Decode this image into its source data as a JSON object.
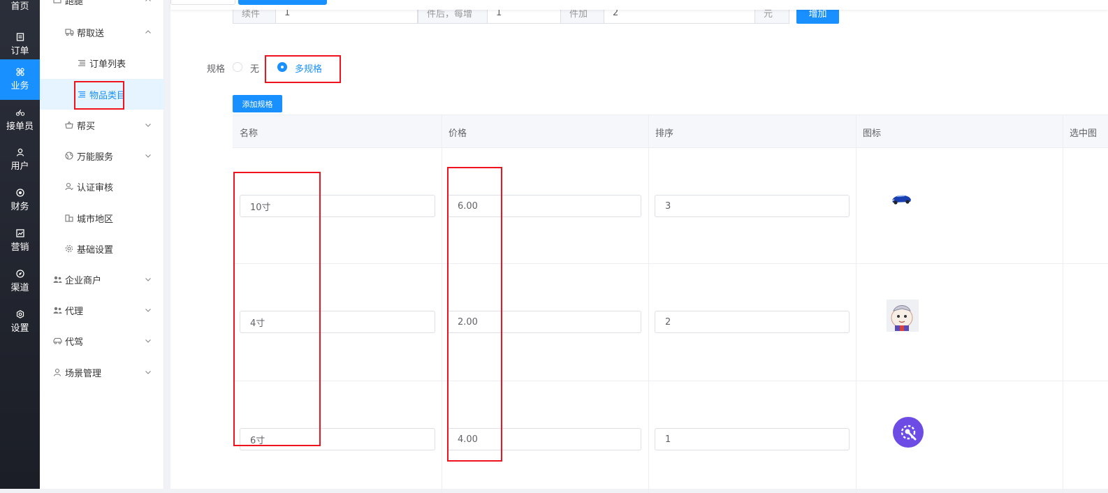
{
  "rail": {
    "items": [
      {
        "label": "首页",
        "icon": "home-icon"
      },
      {
        "label": "订单",
        "icon": "order-icon"
      },
      {
        "label": "业务",
        "icon": "command-icon",
        "active": true
      },
      {
        "label": "接单员",
        "icon": "bike-icon"
      },
      {
        "label": "用户",
        "icon": "user-icon"
      },
      {
        "label": "财务",
        "icon": "finance-icon"
      },
      {
        "label": "营销",
        "icon": "chart-icon"
      },
      {
        "label": "渠道",
        "icon": "compass-icon"
      },
      {
        "label": "设置",
        "icon": "settings-icon"
      }
    ]
  },
  "menu": {
    "items": [
      {
        "label": "跑腿",
        "icon": "errand-icon",
        "chevron": "up"
      },
      {
        "label": "帮取送",
        "icon": "delivery-icon",
        "chevron": "up"
      },
      {
        "label": "订单列表",
        "icon": "list-icon"
      },
      {
        "label": "物品类目",
        "icon": "list-icon",
        "selected": true
      },
      {
        "label": "帮买",
        "icon": "basket-icon",
        "chevron": "down"
      },
      {
        "label": "万能服务",
        "icon": "globe-icon",
        "chevron": "down"
      },
      {
        "label": "认证审核",
        "icon": "user-check-icon"
      },
      {
        "label": "城市地区",
        "icon": "city-icon"
      },
      {
        "label": "基础设置",
        "icon": "gear-icon"
      },
      {
        "label": "企业商户",
        "icon": "users-icon",
        "chevron": "down"
      },
      {
        "label": "代理",
        "icon": "users-icon",
        "chevron": "down"
      },
      {
        "label": "代驾",
        "icon": "car-icon",
        "chevron": "down"
      },
      {
        "label": "场景管理",
        "icon": "user-icon",
        "chevron": "down"
      }
    ]
  },
  "pricing_row": {
    "label1": "续件",
    "value1": "1",
    "label2": "件后，每增",
    "value2": "1",
    "label3": "件加",
    "value3": "2",
    "unit": "元",
    "add_label": "增加"
  },
  "spec": {
    "label": "规格",
    "option_none": "无",
    "option_multi": "多规格",
    "selected": "多规格",
    "add_button": "添加规格"
  },
  "table": {
    "headers": [
      "名称",
      "价格",
      "排序",
      "图标",
      "选中图"
    ],
    "rows": [
      {
        "name": "10寸",
        "price": "6.00",
        "sort": "3",
        "icon": "blue-car-icon"
      },
      {
        "name": "4寸",
        "price": "2.00",
        "sort": "2",
        "icon": "ultraman-cartoon-icon"
      },
      {
        "name": "6寸",
        "price": "4.00",
        "sort": "1",
        "icon": "purple-tool-icon"
      }
    ]
  },
  "colors": {
    "primary": "#1890ff",
    "rail_bg": "#23262e",
    "highlight_red": "#f0131e"
  }
}
